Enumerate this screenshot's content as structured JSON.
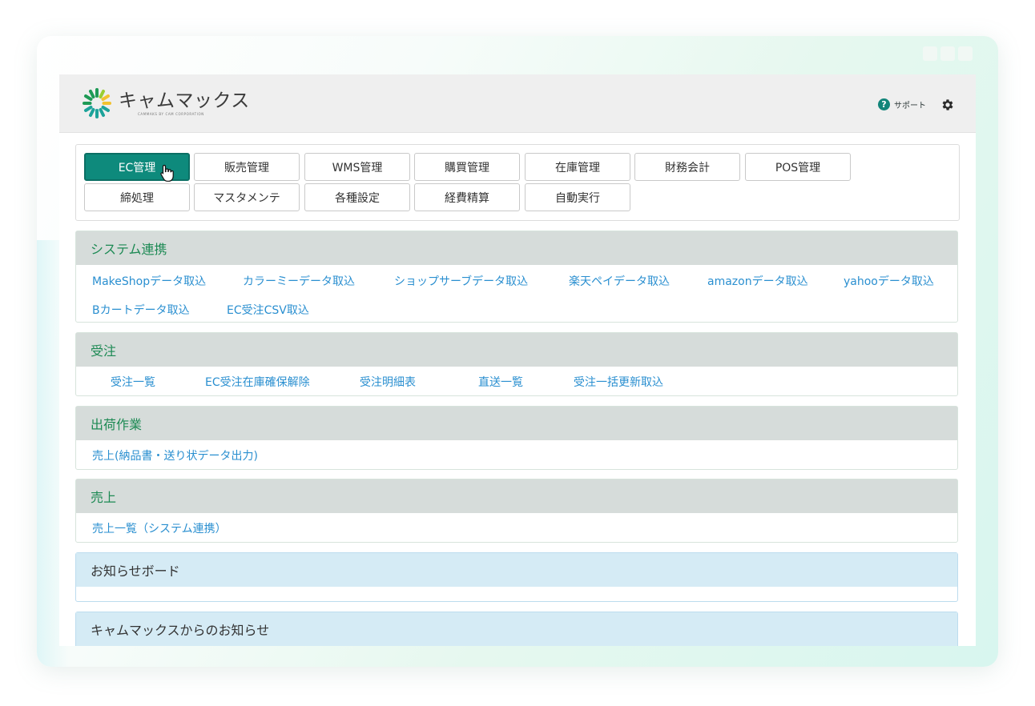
{
  "brand": {
    "name": "キャムマックス",
    "tagline": "CAMMAKS BY CAM CORPORATION"
  },
  "header": {
    "support_label": "サポート",
    "help_glyph": "?",
    "settings_icon": "gear-icon"
  },
  "colors": {
    "accent": "#0e8a7c",
    "section_title": "#1d8a54",
    "link": "#2a8fd0",
    "notice_bg": "#d5ebf5"
  },
  "tabs": [
    {
      "label": "EC管理",
      "active": true
    },
    {
      "label": "販売管理"
    },
    {
      "label": "WMS管理"
    },
    {
      "label": "購買管理"
    },
    {
      "label": "在庫管理"
    },
    {
      "label": "財務会計"
    },
    {
      "label": "POS管理"
    },
    {
      "label": "締処理"
    },
    {
      "label": "マスタメンテ"
    },
    {
      "label": "各種設定"
    },
    {
      "label": "経費精算"
    },
    {
      "label": "自動実行"
    }
  ],
  "sections": [
    {
      "title": "システム連携",
      "links": [
        "MakeShopデータ取込",
        "カラーミーデータ取込",
        "ショップサーブデータ取込",
        "楽天ペイデータ取込",
        "amazonデータ取込",
        "yahooデータ取込",
        "Bカートデータ取込",
        "EC受注CSV取込"
      ]
    },
    {
      "title": "受注",
      "links": [
        "受注一覧",
        "EC受注在庫確保解除",
        "受注明細表",
        "直送一覧",
        "受注一括更新取込"
      ]
    },
    {
      "title": "出荷作業",
      "links": [
        "売上(納品書・送り状データ出力)"
      ]
    },
    {
      "title": "売上",
      "links": [
        "売上一覧（システム連携）"
      ]
    },
    {
      "title": "お知らせボード",
      "links": []
    },
    {
      "title": "キャムマックスからのお知らせ",
      "links": []
    }
  ]
}
